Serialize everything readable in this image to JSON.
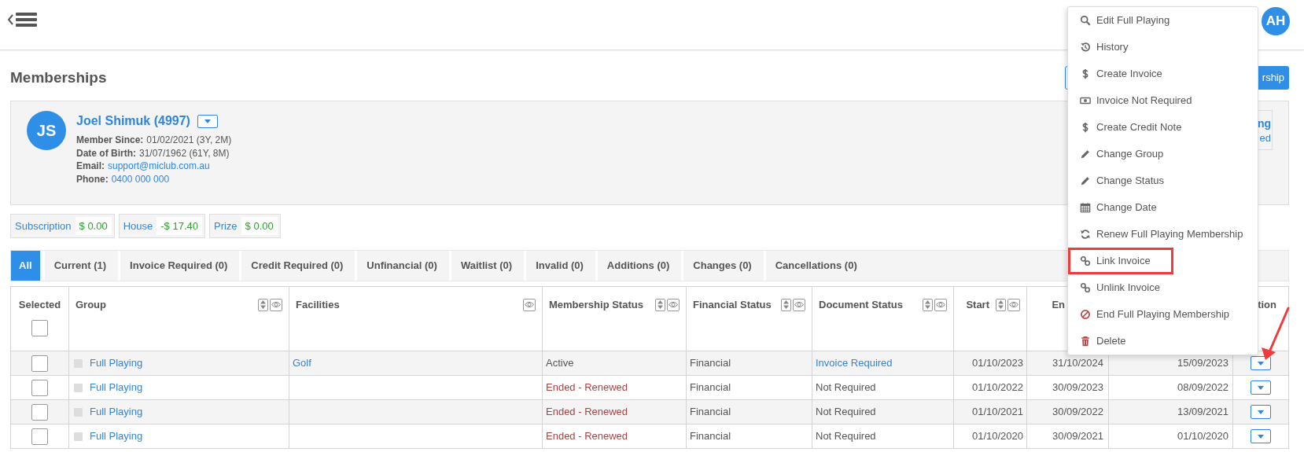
{
  "header": {
    "avatar_initials": "AH"
  },
  "page_title": "Memberships",
  "title_button": {
    "label": "rship"
  },
  "member": {
    "initials": "JS",
    "name": "Joel Shimuk (4997)",
    "details": [
      {
        "label": "Member Since:",
        "value": "01/02/2021 (3Y, 2M)",
        "kind": "text"
      },
      {
        "label": "Date of Birth:",
        "value": "31/07/1962 (61Y, 8M)",
        "kind": "text"
      },
      {
        "label": "Email:",
        "value": "support@miclub.com.au",
        "kind": "link"
      },
      {
        "label": "Phone:",
        "value": "0400 000 000",
        "kind": "link"
      }
    ],
    "side_box": {
      "title": "ng",
      "subtitle": "ed"
    }
  },
  "balances": [
    {
      "label": "Subscription",
      "value": "$ 0.00"
    },
    {
      "label": "House",
      "value": "-$ 17.40"
    },
    {
      "label": "Prize",
      "value": "$ 0.00"
    }
  ],
  "tabs": [
    {
      "label": "All",
      "selected": true
    },
    {
      "label": "Current (1)",
      "selected": false
    },
    {
      "label": "Invoice Required (0)",
      "selected": false
    },
    {
      "label": "Credit Required (0)",
      "selected": false
    },
    {
      "label": "Unfinancial (0)",
      "selected": false
    },
    {
      "label": "Waitlist (0)",
      "selected": false
    },
    {
      "label": "Invalid (0)",
      "selected": false
    },
    {
      "label": "Additions (0)",
      "selected": false
    },
    {
      "label": "Changes (0)",
      "selected": false
    },
    {
      "label": "Cancellations (0)",
      "selected": false
    }
  ],
  "table": {
    "select_all": false,
    "columns": [
      {
        "label": "Selected"
      },
      {
        "label": "Group",
        "sortable": true,
        "hideable": true
      },
      {
        "label": "Facilities",
        "sortable": false,
        "hideable": true
      },
      {
        "label": "Membership Status",
        "sortable": true,
        "hideable": true
      },
      {
        "label": "Financial Status",
        "sortable": true,
        "hideable": true
      },
      {
        "label": "Document Status",
        "sortable": true,
        "hideable": true
      },
      {
        "label": "Start",
        "sortable": true,
        "hideable": true
      },
      {
        "label": "En",
        "sortable": false,
        "hideable": false
      },
      {},
      {
        "label": "tion",
        "sortable": false,
        "hideable": false
      }
    ],
    "rows": [
      {
        "selected": false,
        "group": "Full Playing",
        "facilities": "Golf",
        "membership_status": {
          "text": "Active",
          "kind": "active"
        },
        "financial_status": "Financial",
        "document_status": {
          "text": "Invoice Required",
          "kind": "link"
        },
        "start": "01/10/2023",
        "end": "31/10/2024",
        "column_9": "15/09/2023"
      },
      {
        "selected": false,
        "group": "Full Playing",
        "membership_status": {
          "text": "Ended - Renewed",
          "kind": "ended"
        },
        "financial_status": "Financial",
        "document_status": {
          "text": "Not Required",
          "kind": "plain"
        },
        "start": "01/10/2022",
        "end": "30/09/2023",
        "column_9": "08/09/2022"
      },
      {
        "selected": false,
        "group": "Full Playing",
        "membership_status": {
          "text": "Ended - Renewed",
          "kind": "ended"
        },
        "financial_status": "Financial",
        "document_status": {
          "text": "Not Required",
          "kind": "plain"
        },
        "start": "01/10/2021",
        "end": "30/09/2022",
        "column_9": "13/09/2021"
      },
      {
        "selected": false,
        "group": "Full Playing",
        "membership_status": {
          "text": "Ended - Renewed",
          "kind": "ended"
        },
        "financial_status": "Financial",
        "document_status": {
          "text": "Not Required",
          "kind": "plain"
        },
        "start": "01/10/2020",
        "end": "30/09/2021",
        "column_9": "01/10/2020"
      }
    ]
  },
  "action_menu": {
    "items": [
      {
        "label": "Edit Full Playing",
        "destructive": false,
        "highlighted": false
      },
      {
        "label": "History",
        "destructive": false,
        "highlighted": false
      },
      {
        "label": "Create Invoice",
        "destructive": false,
        "highlighted": false
      },
      {
        "label": "Invoice Not Required",
        "destructive": false,
        "highlighted": false
      },
      {
        "label": "Create Credit Note",
        "destructive": false,
        "highlighted": false
      },
      {
        "label": "Change Group",
        "destructive": false,
        "highlighted": false
      },
      {
        "label": "Change Status",
        "destructive": false,
        "highlighted": false
      },
      {
        "label": "Change Date",
        "destructive": false,
        "highlighted": false
      },
      {
        "label": "Renew Full Playing Membership",
        "destructive": false,
        "highlighted": false
      },
      {
        "label": "Link Invoice",
        "destructive": false,
        "highlighted": true
      },
      {
        "label": "Unlink Invoice",
        "destructive": false,
        "highlighted": false
      },
      {
        "label": "End Full Playing Membership",
        "destructive": true,
        "highlighted": false
      },
      {
        "label": "Delete",
        "destructive": true,
        "highlighted": false
      }
    ]
  }
}
